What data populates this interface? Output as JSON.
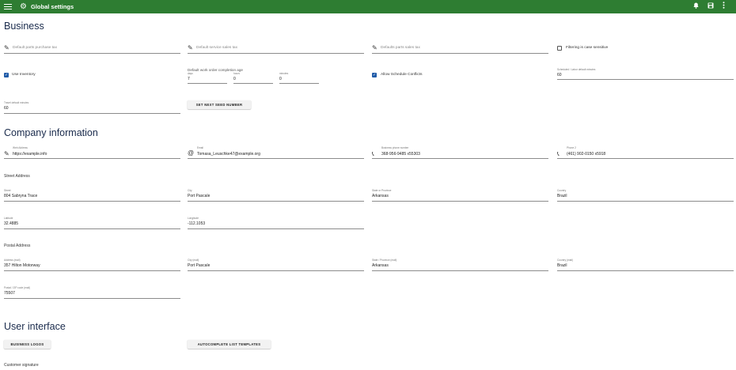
{
  "appbar": {
    "title": "Global settings",
    "color": "#2e7d32"
  },
  "business": {
    "heading": "Business",
    "parts_purchase_tax": "Default parts purchase tax",
    "service_sales_tax": "Default service sales tax",
    "parts_sales_tax": "Defaults parts sales tax",
    "filtering_case_sensitive": "Filtering is case sensitive",
    "use_inventory": "Use Inventory",
    "wo_completion_label": "Default work order completion age",
    "days_label": "days",
    "days_value": "7",
    "hours_label": "hours",
    "hours_value": "0",
    "minutes_label": "minutes",
    "minutes_value": "0",
    "allow_schedule_conflicts": "Allow Schedule Conflicts",
    "labor_minutes_label": "Scheduled / Labor default minutes",
    "labor_minutes_value": "60",
    "travel_minutes_label": "Travel default minutes",
    "travel_minutes_value": "60",
    "seed_button": "SET NEXT SEED NUMBER"
  },
  "company": {
    "heading": "Company information",
    "web_label": "Web Address",
    "web_value": "https://example.info",
    "email_label": "Email",
    "email_value": "Tomasa_Leuschke47@example.org",
    "phone_label": "Business phone number",
    "phone_value": "368-956-9485 x55303",
    "phone2_label": "Phone 2",
    "phone2_value": "(461) 902-0150 x5918",
    "street_section": "Street Address",
    "street_label": "Street",
    "street_value": "804 Sabryna Trace",
    "city_label": "City",
    "city_value": "Port Pascale",
    "state_label": "State or Province",
    "state_value": "Arkansas",
    "country_label": "Country",
    "country_value": "Brazil",
    "lat_label": "Latitude",
    "lat_value": "32.4885",
    "lng_label": "Longitude",
    "lng_value": "-112.1053",
    "postal_section": "Postal Address",
    "paddr_label": "Address (mail)",
    "paddr_value": "357 Hilton Motorway",
    "pcity_label": "City (mail)",
    "pcity_value": "Port Pascale",
    "pstate_label": "State / Province (mail)",
    "pstate_value": "Arkansas",
    "pcountry_label": "Country (mail)",
    "pcountry_value": "Brazil",
    "pzip_label": "Postal / ZIP code (mail)",
    "pzip_value": "75507"
  },
  "ui": {
    "heading": "User interface",
    "logos_button": "BUSINESS LOGOS",
    "templates_button": "AUTOCOMPLETE LIST TEMPLATES",
    "signature_label": "Customer signature"
  }
}
